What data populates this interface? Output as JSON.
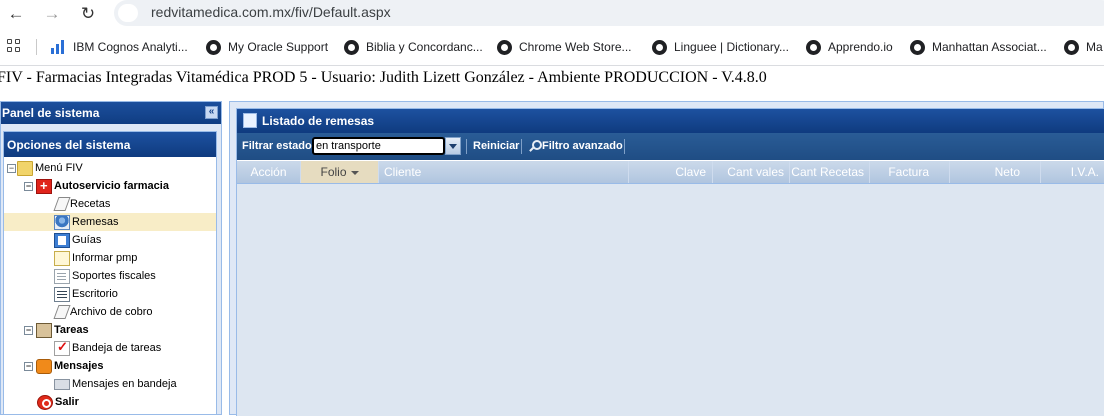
{
  "browser": {
    "url": "redvitamedica.com.mx/fiv/Default.aspx",
    "bookmarks": [
      "IBM Cognos Analyti...",
      "My Oracle Support",
      "Biblia y Concordanc...",
      "Chrome Web Store...",
      "Linguee | Dictionary...",
      "Apprendo.io",
      "Manhattan Associat...",
      "Ma"
    ]
  },
  "app": {
    "title": "FIV - Farmacias Integradas Vitamédica PROD 5 - Usuario: Judith Lizett González - Ambiente PRODUCCION - V.4.8.0"
  },
  "sidebar": {
    "panel_title": "Panel de sistema",
    "collapse_glyph": "«",
    "options_title": "Opciones del sistema",
    "menu_root": "Menú FIV",
    "groups": {
      "autoservicio": "Autoservicio farmacia",
      "tareas": "Tareas",
      "mensajes": "Mensajes",
      "salir": "Salir"
    },
    "items": {
      "recetas": "Recetas",
      "remesas": "Remesas",
      "guias": "Guías",
      "informar_pmp": "Informar pmp",
      "soportes_fiscales": "Soportes fiscales",
      "escritorio": "Escritorio",
      "archivo_cobro": "Archivo de cobro",
      "bandeja_tareas": "Bandeja de tareas",
      "mensajes_bandeja": "Mensajes en bandeja"
    },
    "selected_item": "Remesas"
  },
  "main": {
    "title": "Listado de remesas",
    "filter_label": "Filtrar estado:",
    "filter_value": "en transporte",
    "reset_label": "Reiniciar",
    "advanced_filter_label": "Filtro avanzado",
    "columns": [
      "Acción",
      "Folio",
      "Cliente",
      "Clave",
      "Cant vales",
      "Cant Recetas",
      "Factura",
      "Neto",
      "I.V.A."
    ],
    "sorted_column": "Folio",
    "sort_direction": "descending",
    "rows": []
  }
}
